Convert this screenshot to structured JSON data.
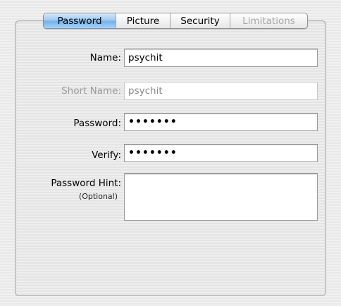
{
  "tabs": [
    {
      "label": "Password",
      "state": "selected"
    },
    {
      "label": "Picture",
      "state": "normal"
    },
    {
      "label": "Security",
      "state": "normal"
    },
    {
      "label": "Limitations",
      "state": "disabled"
    }
  ],
  "form": {
    "name_label": "Name:",
    "name_value": "psychit",
    "short_name_label": "Short Name:",
    "short_name_value": "psychit",
    "password_label": "Password:",
    "password_value": "•••••••",
    "verify_label": "Verify:",
    "verify_value": "•••••••",
    "hint_label": "Password Hint:",
    "hint_sublabel": "(Optional)",
    "hint_value": ""
  },
  "colors": {
    "selected_tab": "#8ec1f0",
    "disabled_text": "#a7a7a7"
  }
}
